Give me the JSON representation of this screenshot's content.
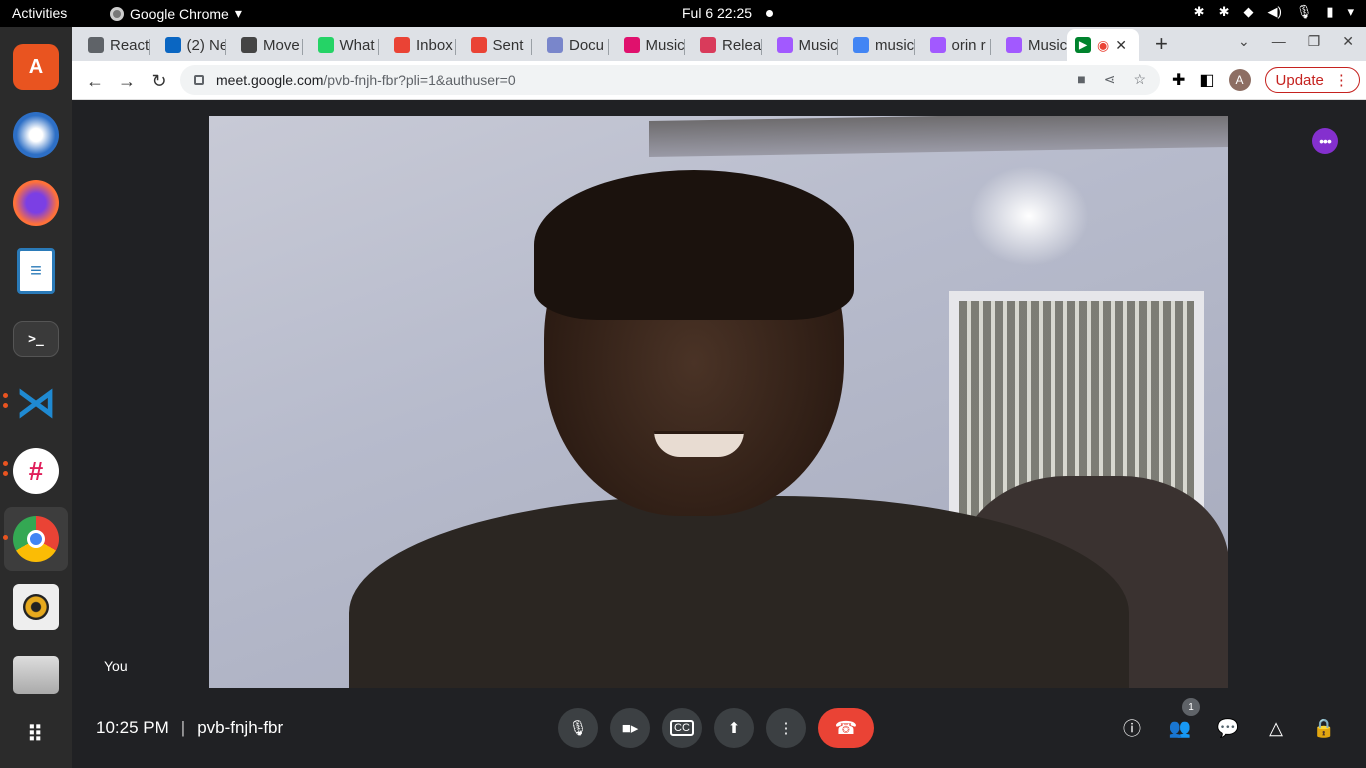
{
  "topbar": {
    "activities": "Activities",
    "app_name": "Google Chrome",
    "clock": "Ful 6  22:25"
  },
  "dock": {
    "apps": [
      "ubuntu-software-icon",
      "thunderbird-icon",
      "firefox-icon",
      "libreoffice-writer-icon",
      "terminal-icon",
      "vscode-icon",
      "slack-icon",
      "chrome-icon",
      "rhythmbox-icon",
      "files-icon",
      "show-apps-icon"
    ]
  },
  "tabs": [
    {
      "title": "React",
      "fav": "video-icon"
    },
    {
      "title": "(2) Ne",
      "fav": "linkedin-icon"
    },
    {
      "title": "Move",
      "fav": "c-icon"
    },
    {
      "title": "What",
      "fav": "whatsapp-icon"
    },
    {
      "title": "Inbox",
      "fav": "gmail-icon"
    },
    {
      "title": "Sent",
      "fav": "gmail-icon"
    },
    {
      "title": "Docu",
      "fav": "e-icon"
    },
    {
      "title": "Music",
      "fav": "pink-dot-icon"
    },
    {
      "title": "Relea",
      "fav": "mail-icon"
    },
    {
      "title": "Music",
      "fav": "figma-icon"
    },
    {
      "title": "music",
      "fav": "google-icon"
    },
    {
      "title": "orin r",
      "fav": "figma-icon"
    },
    {
      "title": "Music",
      "fav": "figma-icon"
    }
  ],
  "browser": {
    "url_host": "meet.google.com",
    "url_path": "/pvb-fnjh-fbr?pli=1&authuser=0",
    "avatar_letter": "A",
    "update_label": "Update"
  },
  "meet": {
    "self_label": "You",
    "time": "10:25 PM",
    "separator": "|",
    "meeting_code": "pvb-fnjh-fbr",
    "participants_count": "1"
  }
}
